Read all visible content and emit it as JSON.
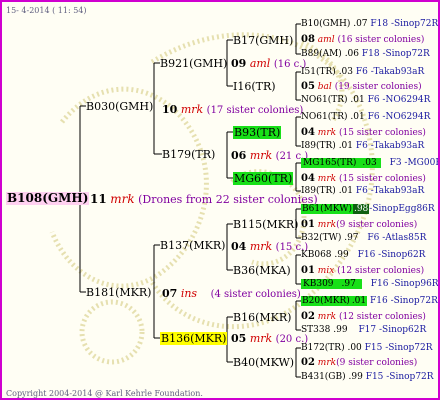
{
  "header": {
    "date": "15- 4-2014 ( 11: 54)"
  },
  "footer": {
    "copyright": "Copyright 2004-2014 @ Karl Kehrle Foundation."
  },
  "root": {
    "id": "B108(GMH)",
    "num": "11",
    "breed": "mrk",
    "note": "(Drones from 22 sister colonies)"
  },
  "upper": {
    "id": "B030(GMH)",
    "num": "10",
    "breed": "mrk",
    "note": "(17 sister colonies)",
    "a": {
      "id": "B921(GMH)",
      "num": "09",
      "breed": "aml",
      "note": "(16 c.)",
      "a": {
        "id": "B17(GMH)",
        "num": "08",
        "breed": "aml",
        "note": "(16 sister colonies)",
        "l1": {
          "id": "B10(GMH)",
          "score": ".07",
          "line": "F18 -Sinop72R"
        },
        "l2": {
          "id": "B89(AM)",
          "score": ".06",
          "line": "F18 -Sinop72R"
        }
      },
      "b": {
        "id": "I16(TR)",
        "num": "05",
        "breed": "bal",
        "note": "(19 sister colonies)",
        "l1": {
          "id": "I51(TR)",
          "score": ".03",
          "line": "F6 -Takab93aR"
        },
        "l2": {
          "id": "NO61(TR)",
          "score": ".01",
          "line": "F6 -NO6294R"
        }
      }
    },
    "b": {
      "id": "B179(TR)",
      "num": "06",
      "breed": "mrk",
      "note": "(21 c.)",
      "a": {
        "id": "B93(TR)",
        "num": "04",
        "breed": "mrk",
        "note": "(15 sister colonies)",
        "l1": {
          "id": "NO61(TR)",
          "score": ".01",
          "line": "F6 -NO6294R"
        },
        "l2": {
          "id": "I89(TR)",
          "score": ".01",
          "line": "F6 -Takab93aR"
        }
      },
      "b": {
        "id": "MG60(TR)",
        "num": "04",
        "breed": "mrk",
        "note": "(15 sister colonies)",
        "l1": {
          "id": "MG165(TR)",
          "score": ".03",
          "line": "F3 -MG00R"
        },
        "l2": {
          "id": "I89(TR)",
          "score": ".01",
          "line": "F6 -Takab93aR"
        }
      }
    }
  },
  "lower": {
    "id": "B181(MKR)",
    "num": "07",
    "breed": "ins",
    "note": "(4 sister colonies)",
    "a": {
      "id": "B137(MKR)",
      "num": "04",
      "breed": "mrk",
      "note": "(15 c.)",
      "a": {
        "id": "B115(MKR)",
        "num": "01",
        "breed": "mrk",
        "note": "(9 sister colonies)",
        "l1": {
          "id": "B61(MKW)",
          "score": ".98",
          "line": "-SinopEgg86R"
        },
        "l2": {
          "id": "B32(TW)",
          "score": ".97",
          "line": "F6 -Atlas85R"
        }
      },
      "b": {
        "id": "B36(MKA)",
        "num": "01",
        "breed": "mix",
        "note": "(12 sister colonies)",
        "l1": {
          "id": "KB068",
          "score": ".99",
          "line": "F16 -Sinop62R"
        },
        "l2": {
          "id": "KB309",
          "score": ".97",
          "line": "F16 -Sinop96R"
        }
      }
    },
    "b": {
      "id": "B136(MKR)",
      "num": "05",
      "breed": "mrk",
      "note": "(20 c.)",
      "a": {
        "id": "B16(MKR)",
        "num": "02",
        "breed": "mrk",
        "note": "(12 sister colonies)",
        "l1": {
          "id": "B20(MKR)",
          "score": ".01",
          "line": "F16 -Sinop72R"
        },
        "l2": {
          "id": "ST338",
          "score": ".99",
          "line": "F17 -Sinop62R"
        }
      },
      "b": {
        "id": "B40(MKW)",
        "num": "02",
        "breed": "mrk",
        "note": "(9 sister colonies)",
        "l1": {
          "id": "B172(TR)",
          "score": ".00",
          "line": "F15 -Sinop72R"
        },
        "l2": {
          "id": "B431(GB)",
          "score": ".99",
          "line": "F15 -Sinop72R"
        }
      }
    }
  }
}
